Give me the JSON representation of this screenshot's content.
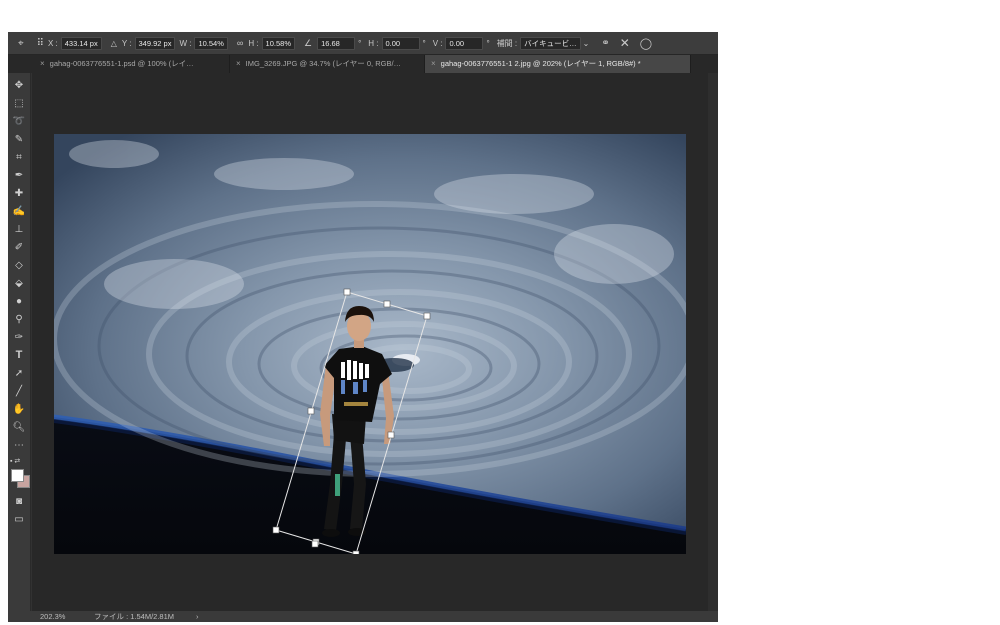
{
  "options": {
    "x_label": "X :",
    "x_value": "433.14 px",
    "y_label": "Y :",
    "y_value": "349.92 px",
    "w_label": "W :",
    "w_value": "10.54%",
    "h_label": "H :",
    "h_value": "10.58%",
    "rotate_value": "16.68",
    "rotate_unit": "°",
    "hskew_label": "H :",
    "hskew_value": "0.00",
    "hskew_unit": "°",
    "vskew_label": "V :",
    "vskew_value": "0.00",
    "vskew_unit": "°",
    "interp_label": "補間 :",
    "interp_value": "バイキュービ…"
  },
  "tabs": [
    {
      "label": "gahag-0063776551-1.psd @ 100% (レイ…"
    },
    {
      "label": "IMG_3269.JPG @ 34.7% (レイヤー 0, RGB/…"
    },
    {
      "label": "gahag-0063776551-1 2.jpg @ 202% (レイヤー 1, RGB/8#) *"
    }
  ],
  "status": {
    "zoom": "202.3%",
    "file": "ファイル : 1.54M/2.81M",
    "arrow": "›"
  },
  "icons": {
    "close": "✕",
    "commit": "◯",
    "link": "∞",
    "triangle": "△",
    "warp": "⚭",
    "tab_close": "×"
  },
  "colors": {
    "app_bg": "#323232",
    "options_bar": "#3d3d3d",
    "active_tab": "#474747",
    "toolbar": "#3a3a3a",
    "transform_box": "#e6e6e6"
  }
}
